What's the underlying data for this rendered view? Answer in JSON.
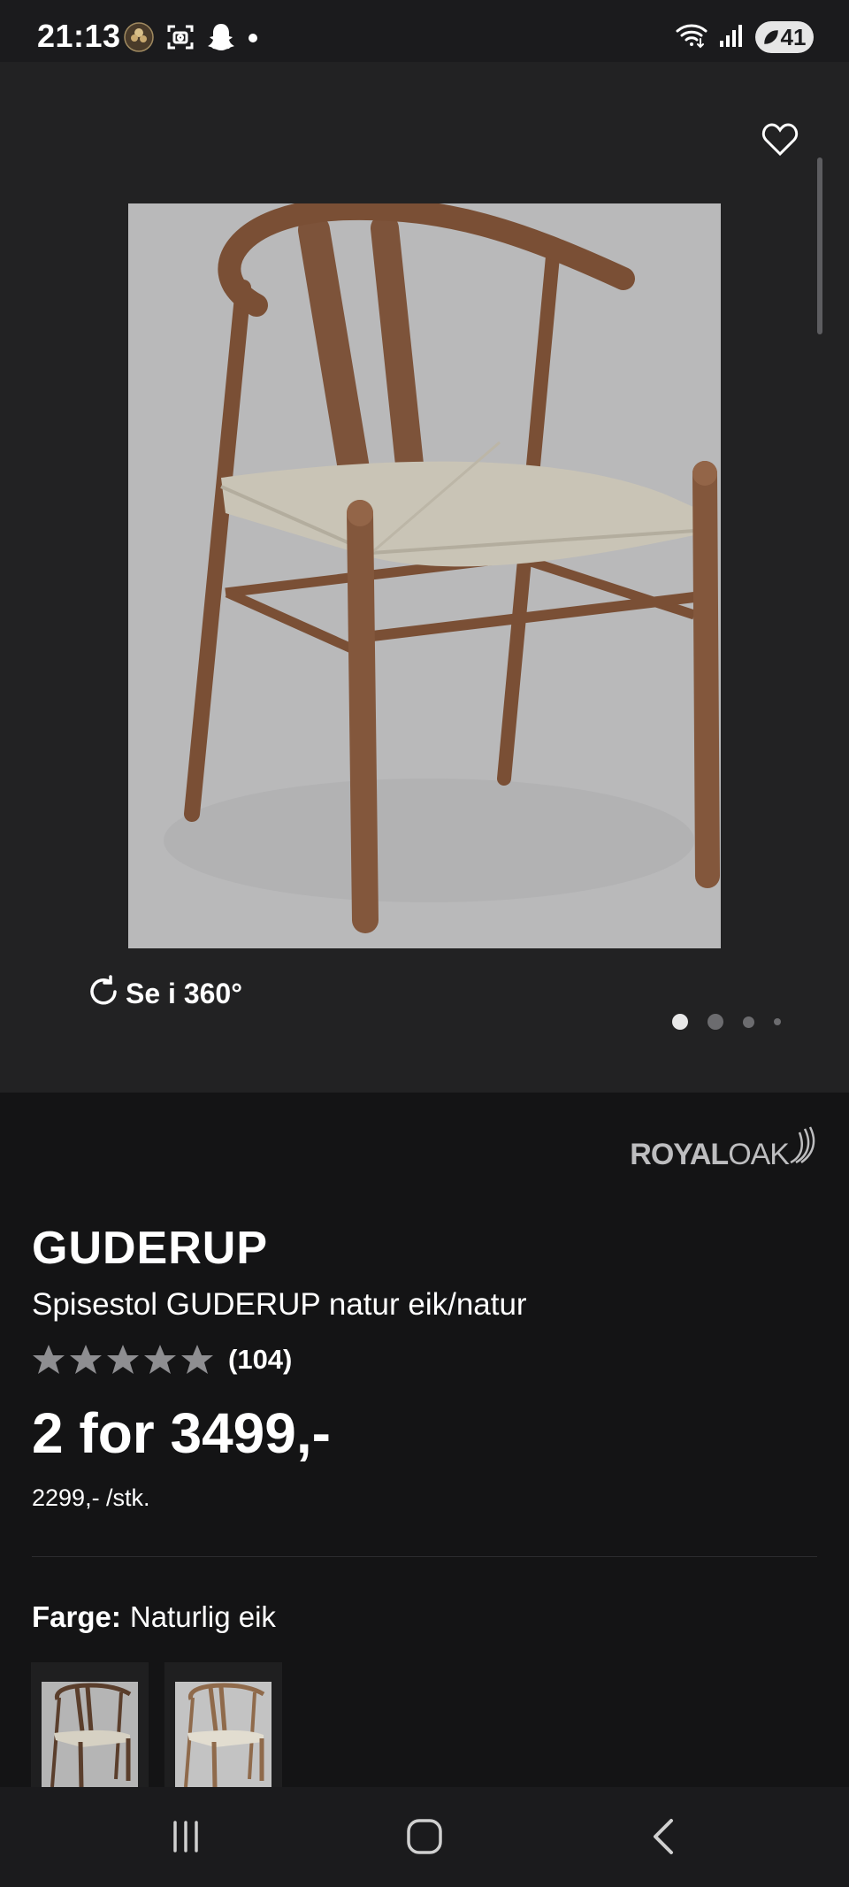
{
  "status_bar": {
    "time": "21:13",
    "battery": "41",
    "icons": [
      "flower-icon",
      "camera-scan-icon",
      "snapchat-ghost-icon",
      "dot-icon",
      "wifi-icon",
      "signal-icon",
      "battery-icon"
    ]
  },
  "gallery": {
    "view_360_label": "Se i 360°",
    "slide_count": 4,
    "active_slide": 1
  },
  "product": {
    "brand_royal": "ROYAL",
    "brand_oak": "OAK",
    "title": "GUDERUP",
    "subtitle": "Spisestol GUDERUP natur eik/natur",
    "rating_stars": 5,
    "rating_count": "(104)",
    "price": "2 for 3499,-",
    "unit_price": "2299,- /stk.",
    "color_label": "Farge:",
    "color_value": "Naturlig eik"
  },
  "colors": {
    "background": "#141415",
    "gallery_background": "#222223",
    "image_background": "#b9b9ba",
    "wood": "#7a4f35",
    "seat": "#c9c4b6",
    "star": "#8e8e91"
  }
}
